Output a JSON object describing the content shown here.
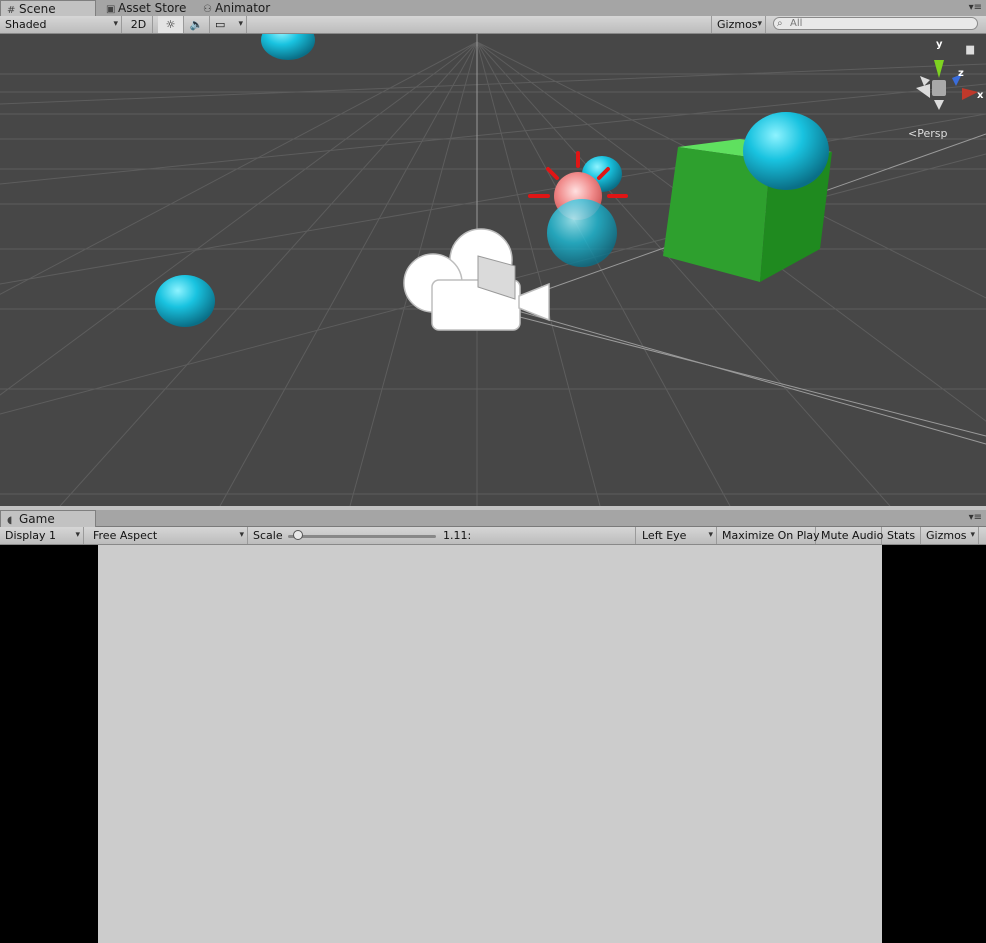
{
  "scene_panel": {
    "tabs": [
      {
        "label": "Scene",
        "icon": "grid-icon"
      },
      {
        "label": "Asset Store",
        "icon": "bag-icon"
      },
      {
        "label": "Animator",
        "icon": "animator-icon"
      }
    ],
    "toolbar": {
      "shading_mode": "Shaded",
      "mode_2d": "2D",
      "gizmos": "Gizmos",
      "search_placeholder": "All"
    },
    "orientation_gizmo": {
      "y": "y",
      "z": "z",
      "x": "x",
      "projection": "Persp"
    }
  },
  "game_panel": {
    "tab": {
      "label": "Game",
      "icon": "pacman-icon"
    },
    "toolbar": {
      "display": "Display 1",
      "aspect": "Free Aspect",
      "scale_label": "Scale",
      "scale_value": "1.11:",
      "scale_fraction": 0.07,
      "eye": "Left Eye",
      "maximize_on_play": "Maximize On Play",
      "mute_audio": "Mute Audio",
      "stats": "Stats",
      "gizmos": "Gizmos"
    }
  },
  "colors": {
    "scene_bg": "#474747",
    "sphere": "#19c3e0",
    "cube": "#2ea02e",
    "light_gizmo": "#e01515",
    "axis_y": "#7ed321",
    "axis_z": "#3a6ddb",
    "axis_x": "#c0392b",
    "game_canvas": "#cccccc"
  }
}
